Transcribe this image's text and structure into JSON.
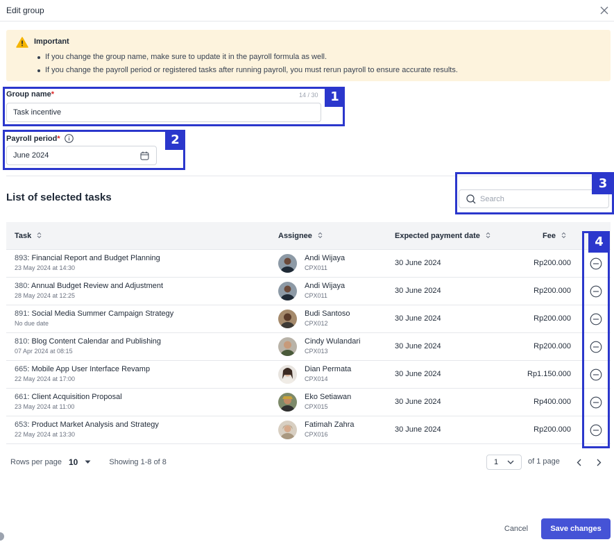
{
  "header": {
    "title": "Edit group",
    "close_icon": "close-icon"
  },
  "alert": {
    "icon": "warning-icon",
    "title": "Important",
    "items": [
      "If you change the group name, make sure to update it in the payroll formula as well.",
      "If you change the payroll period or registered tasks after running payroll, you must rerun payroll to ensure accurate results."
    ]
  },
  "form": {
    "group_name": {
      "label": "Group name",
      "required_mark": "*",
      "counter": "14 / 30",
      "value": "Task incentive"
    },
    "payroll_period": {
      "label": "Payroll period",
      "required_mark": "*",
      "value": "June 2024",
      "info_icon": "info-icon",
      "calendar_icon": "calendar-icon"
    }
  },
  "annotations": [
    "1",
    "2",
    "3",
    "4"
  ],
  "tasks_section": {
    "title": "List of selected tasks",
    "search_placeholder": "Search"
  },
  "table": {
    "columns": [
      "Task",
      "Assignee",
      "Expected payment date",
      "Fee"
    ],
    "rows": [
      {
        "id": "893",
        "title": "Financial Report and Budget Planning",
        "date": "23 May 2024 at 14:30",
        "assignee": "Andi Wijaya",
        "code": "CPX011",
        "pay_date": "30 June 2024",
        "fee": "Rp200.000"
      },
      {
        "id": "380",
        "title": "Annual Budget Review and Adjustment",
        "date": "28 May 2024 at 12:25",
        "assignee": "Andi Wijaya",
        "code": "CPX011",
        "pay_date": "30 June 2024",
        "fee": "Rp200.000"
      },
      {
        "id": "891",
        "title": "Social Media Summer Campaign Strategy",
        "date": "No due date",
        "assignee": "Budi Santoso",
        "code": "CPX012",
        "pay_date": "30 June 2024",
        "fee": "Rp200.000"
      },
      {
        "id": "810",
        "title": "Blog Content Calendar and Publishing",
        "date": "07 Apr 2024 at 08:15",
        "assignee": "Cindy Wulandari",
        "code": "CPX013",
        "pay_date": "30 June 2024",
        "fee": "Rp200.000"
      },
      {
        "id": "665",
        "title": "Mobile App User Interface Revamp",
        "date": "22 May 2024 at 17:00",
        "assignee": "Dian Permata",
        "code": "CPX014",
        "pay_date": "30 June 2024",
        "fee": "Rp1.150.000"
      },
      {
        "id": "661",
        "title": "Client Acquisition Proposal",
        "date": "23 May 2024 at 11:00",
        "assignee": "Eko Setiawan",
        "code": "CPX015",
        "pay_date": "30 June 2024",
        "fee": "Rp400.000"
      },
      {
        "id": "653",
        "title": "Product Market Analysis and Strategy",
        "date": "22 May 2024 at 13:30",
        "assignee": "Fatimah Zahra",
        "code": "CPX016",
        "pay_date": "30 June 2024",
        "fee": "Rp200.000"
      }
    ]
  },
  "pagination": {
    "rows_per_page_label": "Rows per page",
    "rows_per_page_value": "10",
    "showing": "Showing 1-8 of 8",
    "page_value": "1",
    "of_pages": "of 1 page"
  },
  "actions": {
    "cancel": "Cancel",
    "save": "Save changes"
  },
  "colors": {
    "accent": "#4553d6",
    "annotation": "#2b37cc",
    "alert_bg": "#fdf3dd",
    "warning": "#f5b400"
  }
}
